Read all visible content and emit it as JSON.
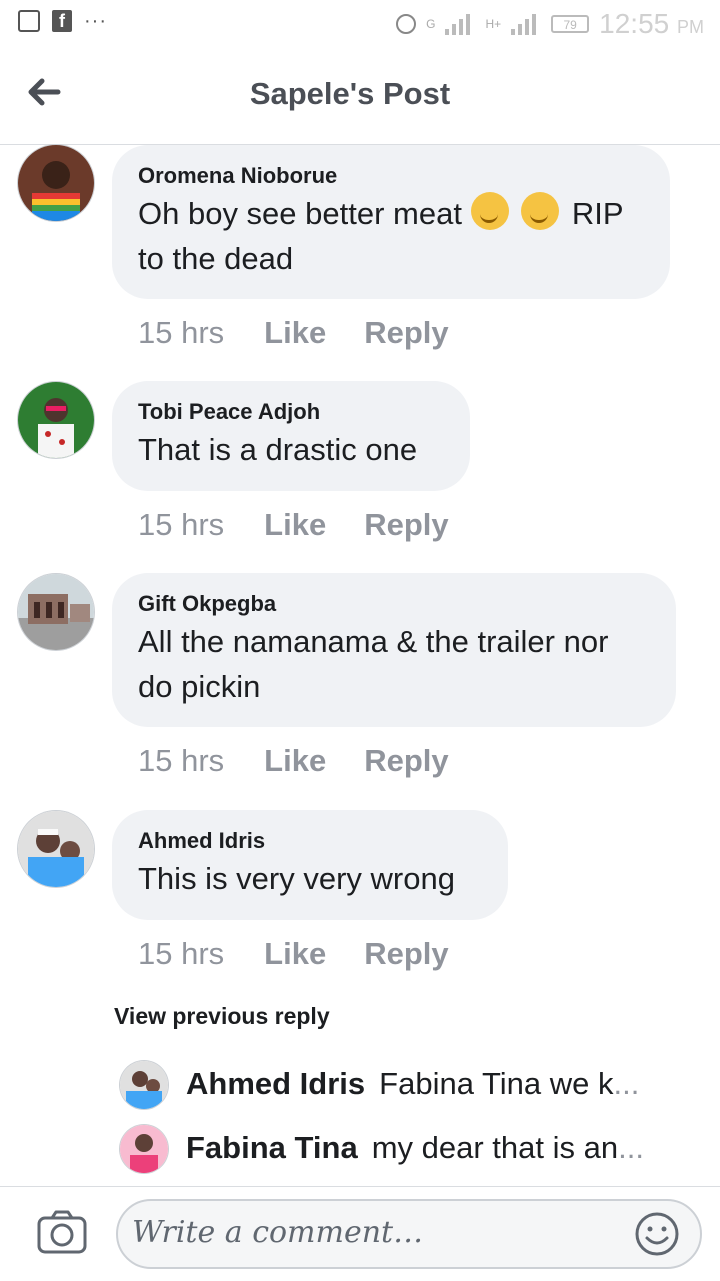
{
  "status_bar": {
    "time": "12:55",
    "ampm": "PM",
    "battery": "79",
    "network_1": "G",
    "network_2": "H+"
  },
  "header": {
    "title": "Sapele's Post",
    "back_icon": "back-arrow-icon"
  },
  "comments": [
    {
      "name": "Oromena Nioborue",
      "text_before": "Oh boy see better meat ",
      "emoji_count": 2,
      "text_line2": "RIP to the dead",
      "time": "15 hrs",
      "like": "Like",
      "reply": "Reply"
    },
    {
      "name": "Tobi Peace Adjoh",
      "text": "That is a drastic one",
      "time": "15 hrs",
      "like": "Like",
      "reply": "Reply"
    },
    {
      "name": "Gift Okpegba",
      "text": "All the namanama & the trailer nor do pickin",
      "time": "15 hrs",
      "like": "Like",
      "reply": "Reply"
    },
    {
      "name": "Ahmed Idris",
      "text": "This is very very wrong",
      "time": "15 hrs",
      "like": "Like",
      "reply": "Reply"
    }
  ],
  "view_previous": "View previous reply",
  "replies": [
    {
      "name": "Ahmed Idris",
      "text": "Fabina Tina we k",
      "ellipsis": "..."
    },
    {
      "name": "Fabina Tina",
      "text": "my dear that is an",
      "ellipsis": "..."
    }
  ],
  "composer": {
    "placeholder": "Write a comment…",
    "camera_icon": "camera-icon",
    "emoji_icon": "smiley-icon"
  },
  "colors": {
    "bubble": "#f0f2f5",
    "meta_text": "#90949c",
    "title": "#4b4f56"
  }
}
